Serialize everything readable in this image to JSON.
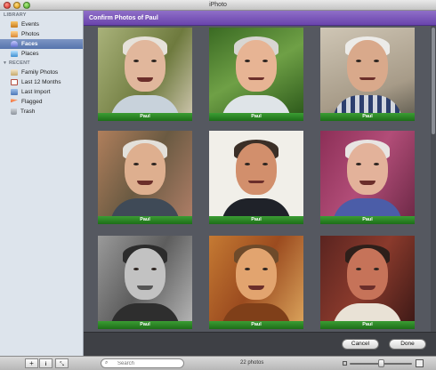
{
  "window": {
    "title": "iPhoto"
  },
  "sidebar": {
    "library_header": "LIBRARY",
    "library_items": [
      {
        "label": "Events",
        "icon": "events-icon"
      },
      {
        "label": "Photos",
        "icon": "photos-icon"
      },
      {
        "label": "Faces",
        "icon": "faces-icon",
        "selected": true
      },
      {
        "label": "Places",
        "icon": "places-icon"
      }
    ],
    "recent_header": "RECENT",
    "recent_items": [
      {
        "label": "Family Photos",
        "icon": "album-icon"
      },
      {
        "label": "Last 12 Months",
        "icon": "calendar-icon"
      },
      {
        "label": "Last Import",
        "icon": "import-icon"
      },
      {
        "label": "Flagged",
        "icon": "flag-icon"
      },
      {
        "label": "Trash",
        "icon": "trash-icon"
      }
    ]
  },
  "header": {
    "title": "Confirm Photos of Paul",
    "color": "#7a55bb"
  },
  "faces": [
    {
      "name": "Paul"
    },
    {
      "name": "Paul"
    },
    {
      "name": "Paul"
    },
    {
      "name": "Paul"
    },
    {
      "name": "Paul"
    },
    {
      "name": "Paul"
    },
    {
      "name": "Paul"
    },
    {
      "name": "Paul"
    },
    {
      "name": "Paul"
    }
  ],
  "actions": {
    "cancel": "Cancel",
    "done": "Done"
  },
  "toolbar": {
    "add": "+",
    "info": "i",
    "fullscreen": "⤡",
    "search_placeholder": "Search",
    "photo_count": "22 photos",
    "zoom_level": 0.5
  },
  "colors": {
    "name_bar": "#2b8a25",
    "selection": "#6680b8"
  }
}
